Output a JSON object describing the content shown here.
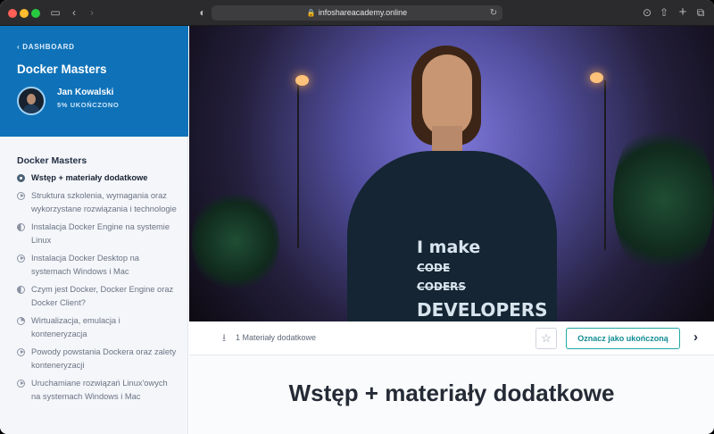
{
  "browser": {
    "url": "infoshareacademy.online",
    "lock_icon": "lock-icon",
    "colors": {
      "toolbar": "#2b2b2d",
      "urlbar": "#3d3d40"
    }
  },
  "sidebar": {
    "back_label": "DASHBOARD",
    "course_title": "Docker Masters",
    "user": {
      "name": "Jan Kowalski",
      "progress": "5% UKOŃCZONO",
      "avatar_icon": "avatar"
    },
    "section_title": "Docker Masters",
    "lessons": [
      {
        "label": "Wstęp + materiały dodatkowe",
        "state": "active",
        "icon": "completed-lesson-icon"
      },
      {
        "label": "Struktura szkolenia, wymagania oraz wykorzystane rozwiązania i technologie",
        "icon": "play-icon"
      },
      {
        "label": "Instalacja Docker Engine na systemie Linux",
        "icon": "half-progress-icon"
      },
      {
        "label": "Instalacja Docker Desktop na systemach Windows i Mac",
        "icon": "play-icon"
      },
      {
        "label": "Czym jest Docker, Docker Engine oraz Docker Client?",
        "icon": "half-progress-icon"
      },
      {
        "label": "Wirtualizacja, emulacja i konteneryzacja",
        "icon": "quarter-progress-icon"
      },
      {
        "label": "Powody powstania Dockera oraz zalety konteneryzacji",
        "icon": "play-icon"
      },
      {
        "label": "Uruchamiane rozwiązań Linux'owych na systemach Windows i Mac",
        "icon": "play-icon"
      }
    ],
    "colors": {
      "header": "#0f72b8",
      "background": "#f4f6fa"
    }
  },
  "video": {
    "shirt_lines": [
      "I make",
      "CODE",
      "CODERS",
      "DEVELOPERS"
    ]
  },
  "materials": {
    "label": "1 Materiały dodatkowe",
    "download_icon": "download-icon",
    "favorite_icon": "star-icon",
    "complete_label": "Oznacz jako ukończoną",
    "next_icon": "chevron-right-icon"
  },
  "lesson": {
    "title": "Wstęp + materiały dodatkowe"
  }
}
